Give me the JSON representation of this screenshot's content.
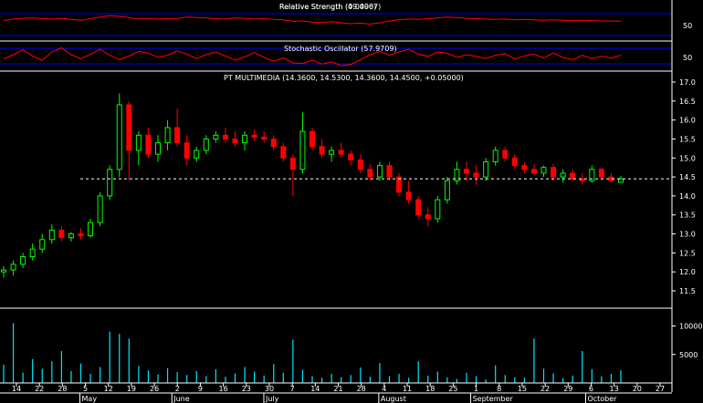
{
  "chart_data": {
    "type": "candlestick",
    "title": "PT MULTIMEDIA (14.3600, 14.5300, 14.3600, 14.4500, +0.05000)",
    "colors": {
      "background": "#000000",
      "up": "#00ff00",
      "down": "#ff0000",
      "volume": "#00e5ff",
      "oscillator": "#ff0000",
      "band": "#0000ff",
      "axis": "#ffffff"
    },
    "indicators": [
      {
        "name": "Relative Strength (49.4967)",
        "label": "Relative Strength (49.4967)",
        "label_overlap": "Relative Strength (0.0000)",
        "y_tick": "50",
        "values": [
          51,
          55,
          57,
          58,
          56,
          55,
          57,
          54,
          52,
          56,
          60,
          64,
          62,
          59,
          55,
          57,
          55,
          56,
          57,
          60,
          59,
          58,
          56,
          55,
          58,
          57,
          55,
          56,
          54,
          53,
          49,
          50,
          47,
          46,
          48,
          45,
          43,
          44,
          42,
          45,
          50,
          53,
          55,
          54,
          56,
          58,
          60,
          59,
          57,
          56,
          55,
          54,
          55,
          53,
          54,
          53,
          52,
          53,
          52,
          51,
          52,
          51,
          50,
          50,
          49
        ]
      },
      {
        "name": "Stochastic Oscillator (57.9709)",
        "label": "Stochastic Oscillator (57.9709)",
        "y_tick": "50",
        "values": [
          45,
          60,
          78,
          55,
          40,
          70,
          85,
          60,
          45,
          62,
          80,
          58,
          42,
          55,
          72,
          66,
          50,
          58,
          74,
          62,
          46,
          60,
          70,
          55,
          40,
          52,
          68,
          50,
          36,
          48,
          30,
          28,
          40,
          26,
          34,
          20,
          24,
          42,
          60,
          72,
          58,
          70,
          80,
          62,
          54,
          70,
          66,
          50,
          60,
          54,
          46,
          58,
          64,
          44,
          56,
          62,
          48,
          66,
          50,
          42,
          58,
          46,
          54,
          48,
          58
        ]
      }
    ],
    "price": {
      "y_ticks": [
        "17.0",
        "16.5",
        "16.0",
        "15.5",
        "15.0",
        "14.5",
        "14.0",
        "13.5",
        "13.0",
        "12.5",
        "12.0",
        "11.5"
      ],
      "ylim": [
        11.5,
        17.0
      ],
      "last_close_line": 14.45,
      "candles": [
        [
          12.0,
          12.15,
          11.85,
          12.05
        ],
        [
          12.05,
          12.3,
          11.9,
          12.2
        ],
        [
          12.2,
          12.5,
          12.1,
          12.4
        ],
        [
          12.4,
          12.75,
          12.3,
          12.6
        ],
        [
          12.6,
          13.0,
          12.5,
          12.85
        ],
        [
          12.85,
          13.25,
          12.75,
          13.1
        ],
        [
          13.1,
          13.2,
          12.8,
          12.9
        ],
        [
          12.9,
          13.05,
          12.8,
          13.0
        ],
        [
          13.0,
          13.15,
          12.85,
          12.95
        ],
        [
          12.95,
          13.4,
          12.9,
          13.3
        ],
        [
          13.3,
          14.1,
          13.2,
          14.0
        ],
        [
          14.0,
          14.8,
          13.9,
          14.7
        ],
        [
          14.7,
          16.7,
          14.5,
          16.4
        ],
        [
          16.4,
          16.5,
          14.4,
          15.2
        ],
        [
          15.2,
          15.7,
          14.8,
          15.6
        ],
        [
          15.6,
          15.8,
          15.0,
          15.1
        ],
        [
          15.1,
          15.6,
          14.9,
          15.4
        ],
        [
          15.4,
          16.0,
          15.2,
          15.8
        ],
        [
          15.8,
          16.3,
          15.3,
          15.4
        ],
        [
          15.4,
          15.6,
          14.8,
          15.0
        ],
        [
          15.0,
          15.3,
          14.9,
          15.2
        ],
        [
          15.2,
          15.6,
          15.1,
          15.5
        ],
        [
          15.5,
          15.7,
          15.4,
          15.6
        ],
        [
          15.6,
          15.8,
          15.4,
          15.5
        ],
        [
          15.5,
          15.7,
          15.3,
          15.4
        ],
        [
          15.4,
          15.7,
          15.2,
          15.6
        ],
        [
          15.6,
          15.75,
          15.45,
          15.55
        ],
        [
          15.55,
          15.7,
          15.4,
          15.5
        ],
        [
          15.5,
          15.6,
          15.2,
          15.3
        ],
        [
          15.3,
          15.4,
          14.9,
          15.0
        ],
        [
          15.0,
          15.1,
          14.0,
          14.7
        ],
        [
          14.7,
          16.2,
          14.6,
          15.7
        ],
        [
          15.7,
          15.8,
          15.2,
          15.3
        ],
        [
          15.3,
          15.5,
          15.0,
          15.1
        ],
        [
          15.1,
          15.3,
          14.9,
          15.2
        ],
        [
          15.2,
          15.4,
          15.0,
          15.1
        ],
        [
          15.1,
          15.2,
          14.8,
          14.95
        ],
        [
          14.95,
          15.1,
          14.6,
          14.7
        ],
        [
          14.7,
          14.85,
          14.4,
          14.5
        ],
        [
          14.5,
          14.9,
          14.4,
          14.8
        ],
        [
          14.8,
          14.9,
          14.4,
          14.5
        ],
        [
          14.5,
          14.6,
          14.0,
          14.1
        ],
        [
          14.1,
          14.4,
          13.8,
          13.9
        ],
        [
          13.9,
          14.0,
          13.4,
          13.5
        ],
        [
          13.5,
          13.7,
          13.2,
          13.4
        ],
        [
          13.4,
          14.0,
          13.3,
          13.9
        ],
        [
          13.9,
          14.5,
          13.8,
          14.4
        ],
        [
          14.4,
          14.9,
          14.3,
          14.7
        ],
        [
          14.7,
          14.9,
          14.4,
          14.6
        ],
        [
          14.6,
          14.8,
          14.3,
          14.5
        ],
        [
          14.5,
          15.0,
          14.4,
          14.9
        ],
        [
          14.9,
          15.3,
          14.8,
          15.2
        ],
        [
          15.2,
          15.3,
          14.9,
          15.0
        ],
        [
          15.0,
          15.1,
          14.7,
          14.8
        ],
        [
          14.8,
          14.9,
          14.6,
          14.7
        ],
        [
          14.7,
          14.85,
          14.55,
          14.6
        ],
        [
          14.6,
          14.8,
          14.5,
          14.75
        ],
        [
          14.75,
          14.85,
          14.4,
          14.5
        ],
        [
          14.5,
          14.7,
          14.35,
          14.6
        ],
        [
          14.6,
          14.7,
          14.4,
          14.45
        ],
        [
          14.45,
          14.6,
          14.3,
          14.4
        ],
        [
          14.4,
          14.8,
          14.35,
          14.7
        ],
        [
          14.7,
          14.75,
          14.4,
          14.5
        ],
        [
          14.5,
          14.6,
          14.35,
          14.4
        ],
        [
          14.36,
          14.53,
          14.36,
          14.45
        ]
      ]
    },
    "volume": {
      "y_ticks": [
        "10000",
        "5000"
      ],
      "ylim": [
        0,
        12000
      ],
      "values": [
        3200,
        10500,
        1800,
        4200,
        2500,
        3800,
        5600,
        2100,
        3400,
        1600,
        2800,
        9000,
        8600,
        7800,
        3000,
        2200,
        1500,
        2600,
        1900,
        1400,
        2100,
        1200,
        2400,
        1100,
        1700,
        2800,
        2000,
        1300,
        3300,
        1800,
        7600,
        2300,
        1200,
        900,
        1600,
        1000,
        1400,
        2700,
        1100,
        3500,
        1200,
        1600,
        900,
        3800,
        1300,
        2000,
        1000,
        700,
        1800,
        1200,
        600,
        3100,
        1400,
        1000,
        900,
        7800,
        2500,
        1700,
        800,
        1300,
        5600,
        2400,
        1200,
        1600,
        2200
      ]
    },
    "x_ticks": [
      "14",
      "22",
      "28",
      "5",
      "12",
      "19",
      "26",
      "2",
      "9",
      "16",
      "23",
      "30",
      "7",
      "14",
      "21",
      "28",
      "4",
      "11",
      "18",
      "25",
      "1",
      "8",
      "15",
      "22",
      "29",
      "6",
      "13",
      "20",
      "27"
    ],
    "months": [
      "May",
      "June",
      "July",
      "August",
      "September",
      "October"
    ]
  }
}
